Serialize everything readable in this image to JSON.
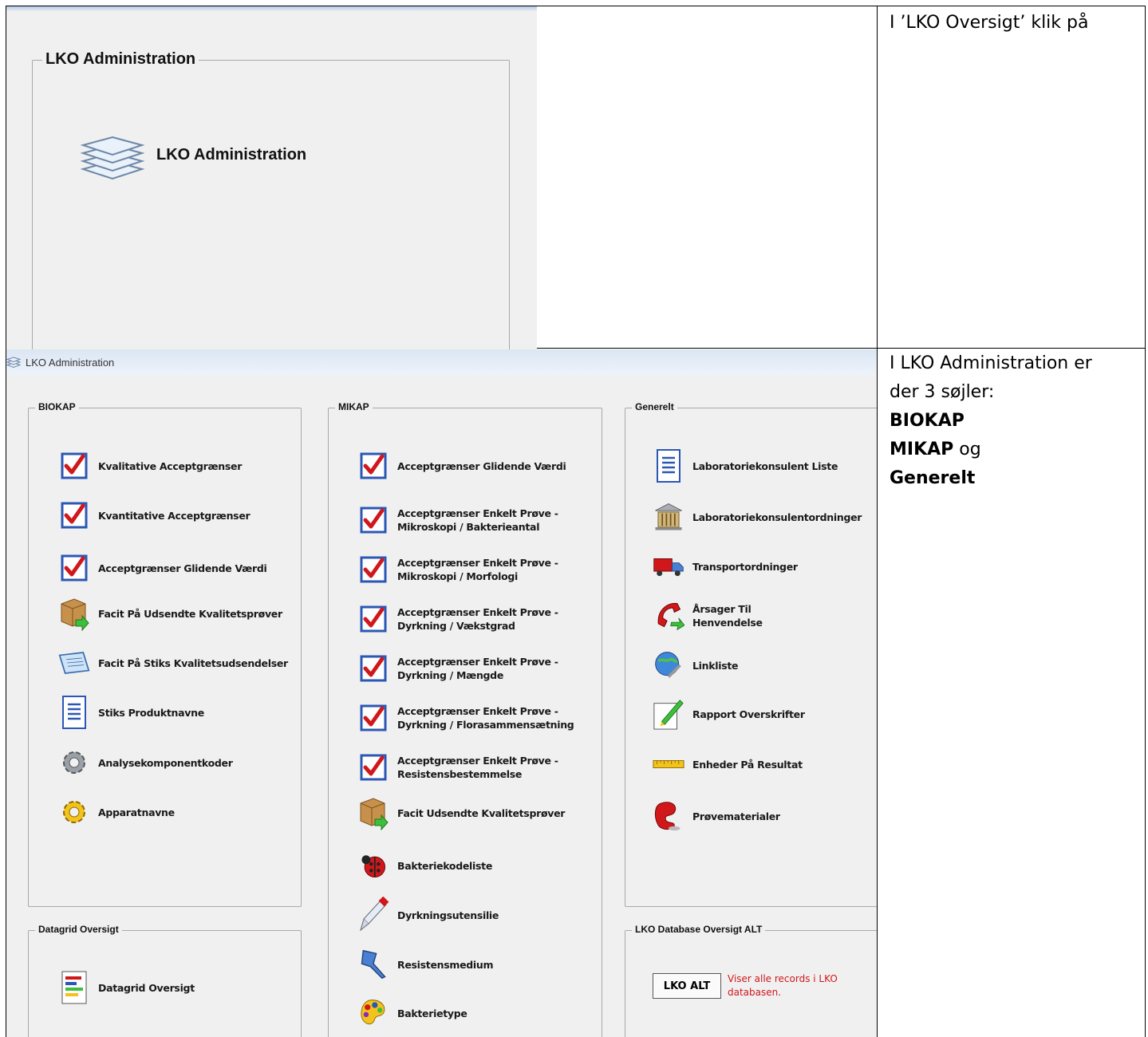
{
  "top_panel": {
    "group_title": "LKO Administration",
    "link_label": "LKO Administration",
    "icon": "layers-icon"
  },
  "notes": {
    "row1": "I ’LKO Oversigt’ klik på",
    "row2_line1": "I LKO Administration er",
    "row2_line2": "der 3 søjler:",
    "row2_biokap": "BIOKAP",
    "row2_mikap": "MIKAP",
    "row2_og": " og",
    "row2_generelt": "Generelt"
  },
  "window": {
    "title": "LKO Administration",
    "icon": "layers-icon"
  },
  "biokap": {
    "title": "BIOKAP",
    "items": [
      {
        "label": "Kvalitative Acceptgrænser",
        "icon": "checkbox-icon"
      },
      {
        "label": "Kvantitative Acceptgrænser",
        "icon": "checkbox-icon"
      },
      {
        "label": "Acceptgrænser Glidende Værdi",
        "icon": "checkbox-icon"
      },
      {
        "label": "Facit På Udsendte Kvalitetsprøver",
        "icon": "package-icon"
      },
      {
        "label": "Facit På Stiks Kvalitetsudsendelser",
        "icon": "document-icon"
      },
      {
        "label": "Stiks Produktnavne",
        "icon": "list-icon"
      },
      {
        "label": "Analysekomponentkoder",
        "icon": "gear-icon"
      },
      {
        "label": "Apparatnavne",
        "icon": "gear-yellow-icon"
      }
    ]
  },
  "datagrid": {
    "title": "Datagrid Oversigt",
    "items": [
      {
        "label": "Datagrid Oversigt",
        "icon": "report-icon"
      }
    ]
  },
  "mikap": {
    "title": "MIKAP",
    "items": [
      {
        "label": "Acceptgrænser Glidende Værdi",
        "icon": "checkbox-icon"
      },
      {
        "label": "Acceptgrænser Enkelt Prøve -\nMikroskopi / Bakterieantal",
        "icon": "checkbox-icon"
      },
      {
        "label": "Acceptgrænser Enkelt Prøve -\nMikroskopi / Morfologi",
        "icon": "checkbox-icon"
      },
      {
        "label": "Acceptgrænser Enkelt Prøve -\nDyrkning / Vækstgrad",
        "icon": "checkbox-icon"
      },
      {
        "label": "Acceptgrænser Enkelt Prøve -\nDyrkning / Mængde",
        "icon": "checkbox-icon"
      },
      {
        "label": "Acceptgrænser Enkelt Prøve -\nDyrkning / Florasammensætning",
        "icon": "checkbox-icon"
      },
      {
        "label": "Acceptgrænser Enkelt Prøve -\nResistensbestemmelse",
        "icon": "checkbox-icon"
      },
      {
        "label": "Facit Udsendte Kvalitetsprøver",
        "icon": "package-icon"
      },
      {
        "label": "Bakteriekodeliste",
        "icon": "ladybug-icon"
      },
      {
        "label": "Dyrkningsutensilie",
        "icon": "pipette-icon"
      },
      {
        "label": "Resistensmedium",
        "icon": "pushpin-icon"
      },
      {
        "label": "Bakterietype",
        "icon": "palette-icon"
      }
    ]
  },
  "generelt": {
    "title": "Generelt",
    "items": [
      {
        "label": "Laboratoriekonsulent Liste",
        "icon": "list-icon"
      },
      {
        "label": "Laboratoriekonsulentordninger",
        "icon": "bank-icon"
      },
      {
        "label": "Transportordninger",
        "icon": "truck-icon"
      },
      {
        "label": "Årsager Til\nHenvendelse",
        "icon": "phone-icon"
      },
      {
        "label": "Linkliste",
        "icon": "globe-link-icon"
      },
      {
        "label": "Rapport Overskrifter",
        "icon": "pencil-icon"
      },
      {
        "label": "Enheder På Resultat",
        "icon": "ruler-icon"
      },
      {
        "label": "Prøvematerialer",
        "icon": "sample-icon"
      }
    ]
  },
  "lko_db": {
    "title": "LKO Database Oversigt ALT",
    "button_label": "LKO ALT",
    "description": "Viser alle records i LKO databasen."
  },
  "colors": {
    "check_red": "#d0181b",
    "box_blue": "#2b57b4",
    "desc_red": "#d0181b"
  }
}
